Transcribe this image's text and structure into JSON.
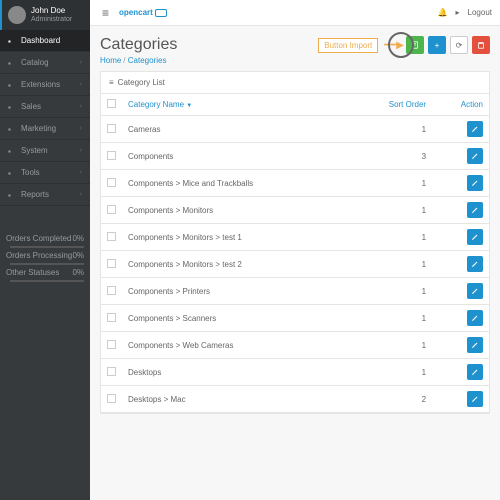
{
  "logo": "opencart",
  "topbar": {
    "logout": "Logout",
    "bell": "🔔"
  },
  "user": {
    "name": "John Doe",
    "role": "Administrator"
  },
  "nav": [
    {
      "label": "Dashboard",
      "active": true
    },
    {
      "label": "Catalog"
    },
    {
      "label": "Extensions"
    },
    {
      "label": "Sales"
    },
    {
      "label": "Marketing"
    },
    {
      "label": "System"
    },
    {
      "label": "Tools"
    },
    {
      "label": "Reports"
    }
  ],
  "stats": [
    {
      "label": "Orders Completed",
      "pct": "0%"
    },
    {
      "label": "Orders Processing",
      "pct": "0%"
    },
    {
      "label": "Other Statuses",
      "pct": "0%"
    }
  ],
  "page": {
    "title": "Categories",
    "crumb_home": "Home",
    "crumb_current": "Categories"
  },
  "actions": {
    "import_label": "Button Import"
  },
  "panel": {
    "title": "Category List"
  },
  "columns": {
    "name": "Category Name",
    "sort": "Sort Order",
    "action": "Action"
  },
  "rows": [
    {
      "name": "Cameras",
      "sort": "1"
    },
    {
      "name": "Components",
      "sort": "3"
    },
    {
      "name": "Components  >  Mice and Trackballs",
      "sort": "1"
    },
    {
      "name": "Components  >  Monitors",
      "sort": "1"
    },
    {
      "name": "Components  >  Monitors  >  test 1",
      "sort": "1"
    },
    {
      "name": "Components  >  Monitors  >  test 2",
      "sort": "1"
    },
    {
      "name": "Components  >  Printers",
      "sort": "1"
    },
    {
      "name": "Components  >  Scanners",
      "sort": "1"
    },
    {
      "name": "Components  >  Web Cameras",
      "sort": "1"
    },
    {
      "name": "Desktops",
      "sort": "1"
    },
    {
      "name": "Desktops  >  Mac",
      "sort": "2"
    }
  ]
}
